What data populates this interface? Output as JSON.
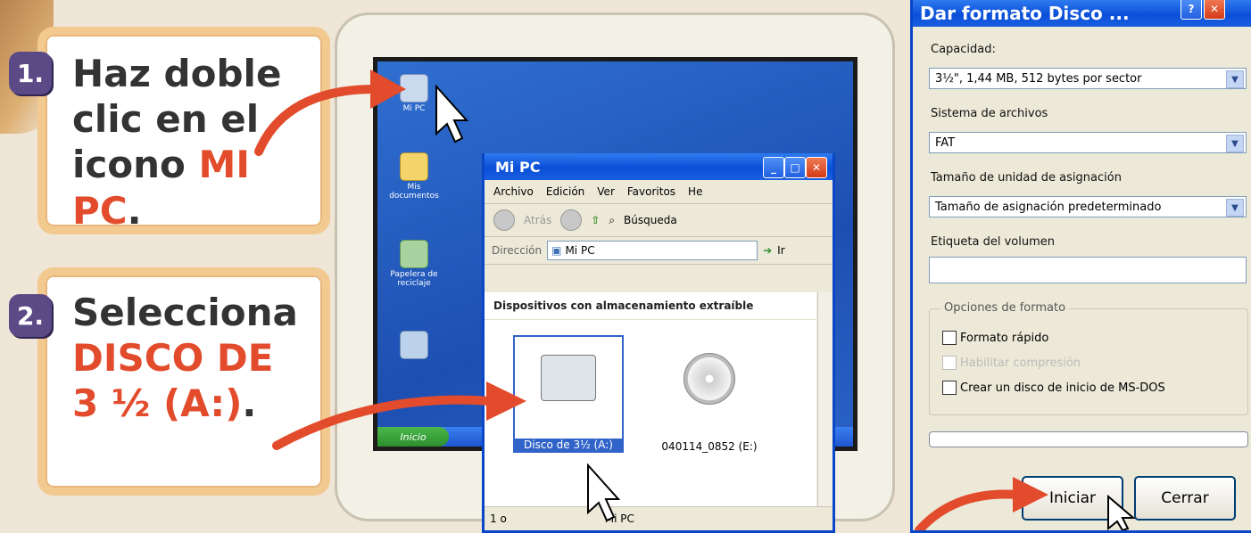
{
  "steps": [
    {
      "number": "1.",
      "lines": [
        "Haz doble",
        "clic en el",
        "icono "
      ],
      "highlight": "MI PC",
      "tail": "."
    },
    {
      "number": "2.",
      "lines": [
        "Selecciona"
      ],
      "highlight_lines": [
        "DISCO  DE",
        "3 ½ (A:)"
      ],
      "tail": "."
    }
  ],
  "desktop": {
    "icons": [
      {
        "label": "Mi PC",
        "icon": "computer-icon"
      },
      {
        "label": "Mis documentos",
        "icon": "folder-icon"
      },
      {
        "label": "Papelera de reciclaje",
        "icon": "recycle-bin-icon"
      },
      {
        "label": "",
        "icon": "network-icon"
      }
    ],
    "start_label": "Inicio"
  },
  "explorer": {
    "title": "Mi PC",
    "menu": [
      "Archivo",
      "Edición",
      "Ver",
      "Favoritos",
      "He"
    ],
    "toolbar": {
      "back": "Atrás",
      "search": "Búsqueda"
    },
    "address_label": "Dirección",
    "address_value": "Mi PC",
    "go_label": "Ir",
    "section": "Dispositivos con almacenamiento extraíble",
    "items": [
      {
        "label": "Disco de 3½ (A:)",
        "icon": "floppy-drive-icon",
        "selected": true
      },
      {
        "label": "040114_0852 (E:)",
        "icon": "cdrom-drive-icon",
        "selected": false
      }
    ],
    "status_left": "1 o",
    "status_right": "Mi PC"
  },
  "format_dialog": {
    "title": "Dar formato Disco ...",
    "capacity_label": "Capacidad:",
    "capacity_value": "3½\", 1,44 MB, 512 bytes por sector",
    "fs_label": "Sistema de archivos",
    "fs_value": "FAT",
    "alloc_label": "Tamaño de unidad de asignación",
    "alloc_value": "Tamaño de asignación predeterminado",
    "volume_label": "Etiqueta del volumen",
    "volume_value": "",
    "options_label": "Opciones de formato",
    "options": [
      {
        "label": "Formato rápido",
        "enabled": true
      },
      {
        "label": "Habilitar compresión",
        "enabled": false
      },
      {
        "label": "Crear un disco de inicio de MS-DOS",
        "enabled": true
      }
    ],
    "start_button": "Iniciar",
    "close_button": "Cerrar"
  },
  "colors": {
    "accent": "#e24b2b",
    "xp_blue": "#0a4fd8",
    "badge": "#5b4a86"
  }
}
